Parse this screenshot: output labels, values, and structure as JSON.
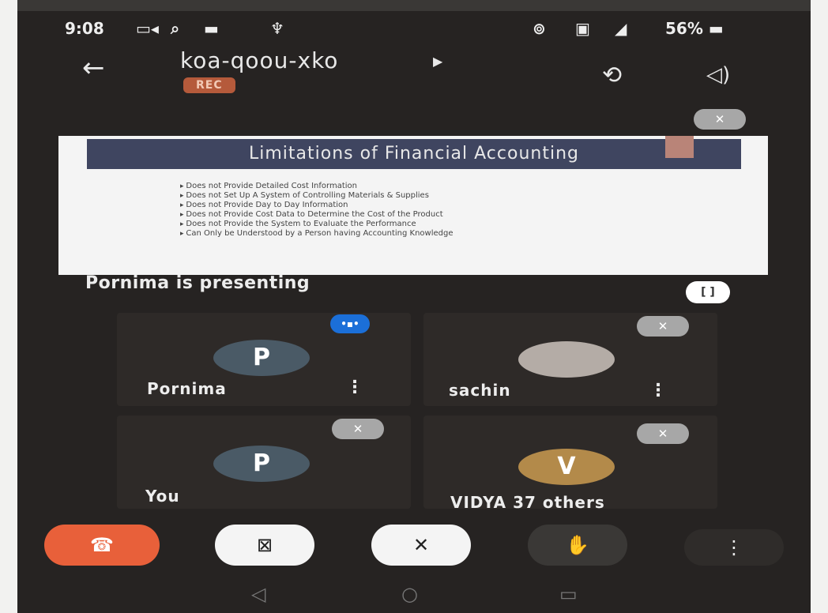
{
  "status_bar": {
    "time": "9:08",
    "left_icons": [
      "video-camera-icon",
      "search-icon",
      "screen-icon",
      "microphone-icon"
    ],
    "right_icons": [
      "hotspot-icon",
      "volte-icon",
      "4g-signal-icon"
    ],
    "battery": "56%"
  },
  "header": {
    "meeting_code": "koa-qoou-xko",
    "rec_badge": "REC"
  },
  "slide": {
    "title": "Limitations of Financial Accounting",
    "bullets": [
      "Does not Provide Detailed Cost Information",
      "Does not Set Up A System of Controlling Materials & Supplies",
      "Does not Provide Day to Day Information",
      "Does not Provide Cost Data to Determine the Cost of the Product",
      "Does not Provide the System to Evaluate the Performance",
      "Can Only be Understood by a Person having Accounting Knowledge"
    ]
  },
  "presenting_label": "Pornima is presenting",
  "participants": [
    {
      "name": "Pornima",
      "initial": "P",
      "avatar_color": "#4a5a66",
      "speaking": true
    },
    {
      "name": "sachin",
      "initial": "",
      "avatar_color": "#b4aca6",
      "speaking": false
    },
    {
      "name": "You",
      "initial": "P",
      "avatar_color": "#4a5a66",
      "speaking": false
    },
    {
      "name": "VIDYA 37 others",
      "initial": "V",
      "avatar_color": "#b38a4a",
      "speaking": false
    }
  ],
  "controls": [
    "end-call-button",
    "camera-off-button",
    "mic-off-button",
    "raise-hand-button",
    "more-options-button"
  ],
  "colors": {
    "background": "#262322",
    "end_call": "#e8603a",
    "rec": "#b55a3b",
    "speaking": "#1b6fd8"
  }
}
